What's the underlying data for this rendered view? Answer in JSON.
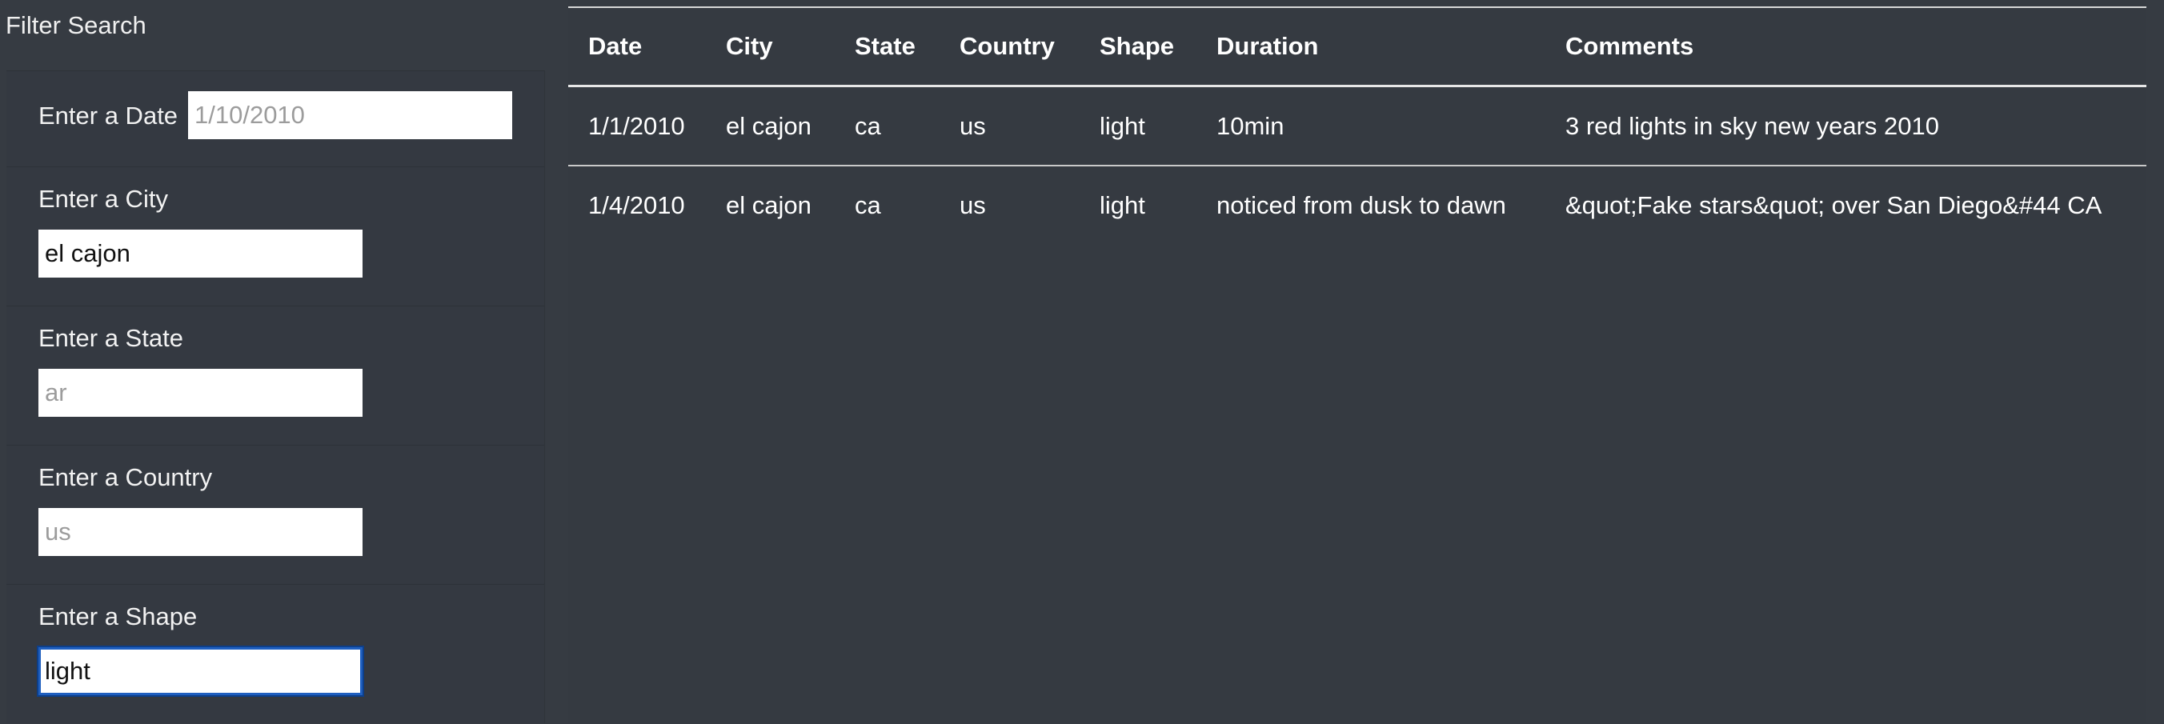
{
  "sidebar": {
    "title": "Filter Search",
    "filters": [
      {
        "id": "date",
        "label": "Enter a Date",
        "value": "",
        "placeholder": "1/10/2010"
      },
      {
        "id": "city",
        "label": "Enter a City",
        "value": "el cajon",
        "placeholder": ""
      },
      {
        "id": "state",
        "label": "Enter a State",
        "value": "",
        "placeholder": "ar"
      },
      {
        "id": "country",
        "label": "Enter a Country",
        "value": "",
        "placeholder": "us"
      },
      {
        "id": "shape",
        "label": "Enter a Shape",
        "value": "light",
        "placeholder": ""
      }
    ]
  },
  "table": {
    "columns": [
      "Date",
      "City",
      "State",
      "Country",
      "Shape",
      "Duration",
      "Comments"
    ],
    "rows": [
      [
        "1/1/2010",
        "el cajon",
        "ca",
        "us",
        "light",
        "10min",
        "3 red lights in sky new years 2010"
      ],
      [
        "1/4/2010",
        "el cajon",
        "ca",
        "us",
        "light",
        "noticed from dusk to dawn",
        "&quot;Fake stars&quot; over San Diego&#44 CA"
      ]
    ]
  },
  "colors": {
    "background": "#363b42",
    "input_focus_border": "#1f5fbf"
  }
}
